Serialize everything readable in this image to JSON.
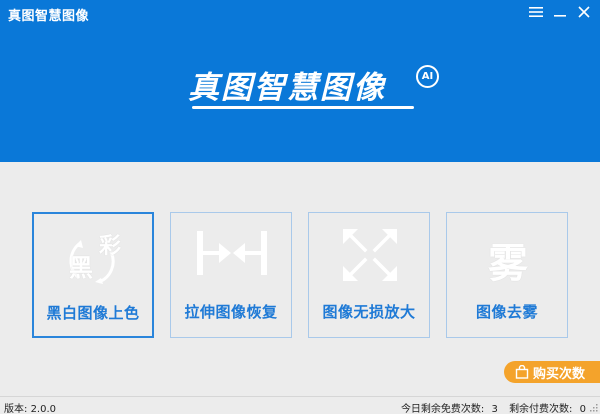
{
  "window": {
    "title": "真图智慧图像"
  },
  "banner": {
    "logo_text": "真图智慧图像",
    "logo_badge": "AI"
  },
  "features": [
    {
      "label": "黑白图像上色",
      "icon": "colorize-icon",
      "glyph_main": "黑",
      "glyph_side": "彩"
    },
    {
      "label": "拉伸图像恢复",
      "icon": "stretch-restore-icon"
    },
    {
      "label": "图像无损放大",
      "icon": "lossless-enlarge-icon"
    },
    {
      "label": "图像去雾",
      "icon": "dehaze-icon",
      "glyph_main": "雾"
    }
  ],
  "buy": {
    "label": "购买次数",
    "icon": "shopping-bag-icon"
  },
  "status": {
    "version_label": "版本:",
    "version_value": "2.0.0",
    "free_label": "今日剩余免费次数:",
    "free_value": "3",
    "paid_label": "剩余付费次数:",
    "paid_value": "0"
  },
  "colors": {
    "banner": "#0a78d8",
    "accent": "#1f7ad6",
    "buy_button": "#f4a32b"
  }
}
